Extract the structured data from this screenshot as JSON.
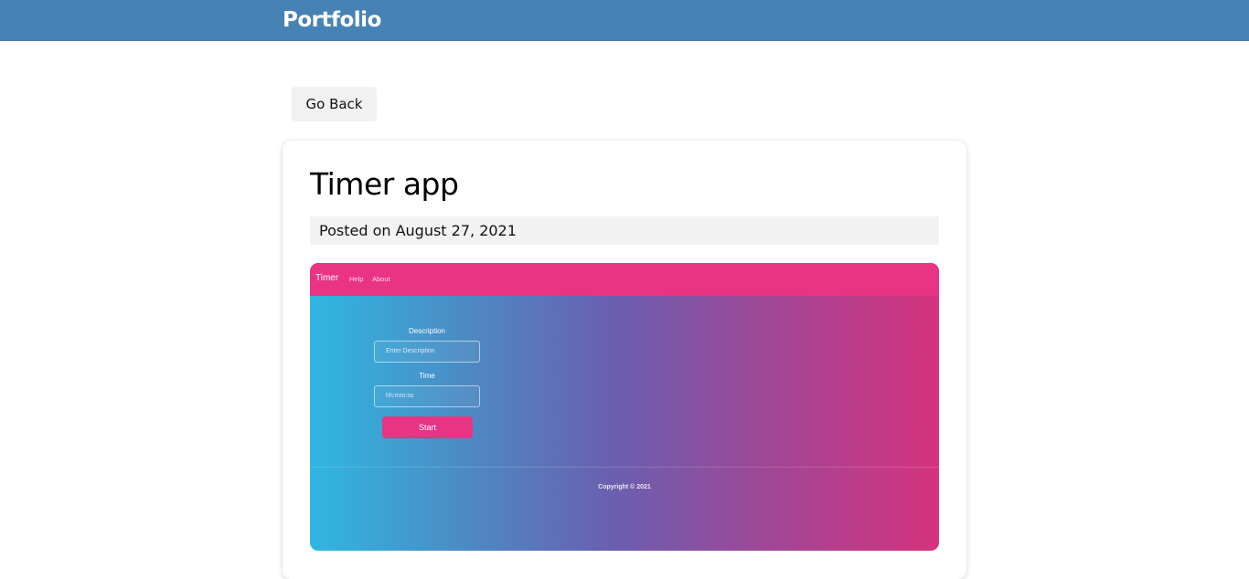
{
  "header": {
    "brand": "Portfolio"
  },
  "nav": {
    "back_label": "Go Back"
  },
  "post": {
    "title": "Timer app",
    "posted": "Posted on August 27, 2021",
    "screenshot": {
      "app_brand": "Timer",
      "nav_links": [
        "Help",
        "About"
      ],
      "description_label": "Description",
      "description_placeholder": "Enter Description",
      "time_label": "Time",
      "time_placeholder": "hh:mm:ss",
      "start_label": "Start",
      "footer": "Copyright © 2021"
    }
  },
  "colors": {
    "header": "#4682b4",
    "accent_pink": "#e93384",
    "gradient_start": "#2fb7e1",
    "gradient_end": "#d6327e"
  }
}
